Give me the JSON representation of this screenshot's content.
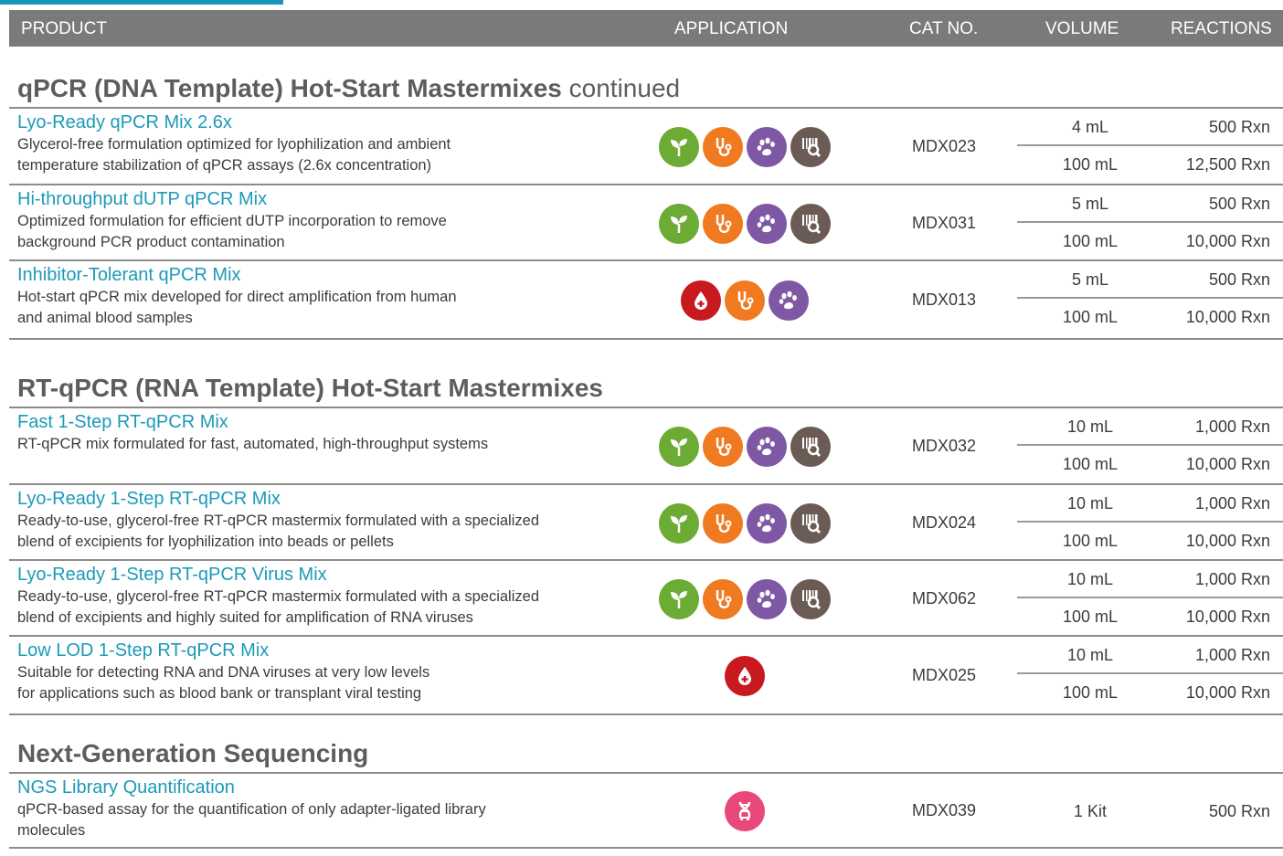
{
  "header": {
    "product": "PRODUCT",
    "application": "APPLICATION",
    "cat_no": "CAT NO.",
    "volume": "VOLUME",
    "reactions": "REACTIONS"
  },
  "colors": {
    "accent": "#1795b5",
    "header_bg": "#7a7a7a",
    "product_name": "#1c9ab8",
    "plant": "#6cab34",
    "medical": "#ef7a1f",
    "veterinary": "#7e58a5",
    "forensic": "#6b5b55",
    "blood": "#c8191f",
    "dna": "#e8497a"
  },
  "sections": [
    {
      "title": "qPCR (DNA Template) Hot-Start Mastermixes",
      "title_suffix": "continued",
      "products": [
        {
          "name": "Lyo-Ready qPCR Mix 2.6x",
          "desc1": "Glycerol-free formulation optimized for lyophilization and ambient",
          "desc2": "temperature stabilization of qPCR assays (2.6x concentration)",
          "icons": [
            "plant-icon",
            "stethoscope-icon",
            "paw-icon",
            "barcode-search-icon"
          ],
          "cat": "MDX023",
          "sizes": [
            {
              "volume": "4 mL",
              "reactions": "500 Rxn"
            },
            {
              "volume": "100 mL",
              "reactions": "12,500 Rxn"
            }
          ]
        },
        {
          "name": "Hi-throughput dUTP qPCR Mix",
          "desc1": "Optimized formulation for efficient dUTP incorporation to remove",
          "desc2": "background PCR product contamination",
          "icons": [
            "plant-icon",
            "stethoscope-icon",
            "paw-icon",
            "barcode-search-icon"
          ],
          "cat": "MDX031",
          "sizes": [
            {
              "volume": "5 mL",
              "reactions": "500 Rxn"
            },
            {
              "volume": "100 mL",
              "reactions": "10,000 Rxn"
            }
          ]
        },
        {
          "name": "Inhibitor-Tolerant qPCR Mix",
          "desc1": "Hot-start qPCR mix developed for direct amplification from human",
          "desc2": "and animal blood samples",
          "icons": [
            "blood-drop-icon",
            "stethoscope-icon",
            "paw-icon"
          ],
          "cat": "MDX013",
          "sizes": [
            {
              "volume": "5 mL",
              "reactions": "500 Rxn"
            },
            {
              "volume": "100 mL",
              "reactions": "10,000 Rxn"
            }
          ]
        }
      ]
    },
    {
      "title": "RT-qPCR (RNA Template) Hot-Start Mastermixes",
      "title_suffix": "",
      "products": [
        {
          "name": "Fast 1-Step RT-qPCR Mix",
          "desc1": "RT-qPCR mix formulated for fast, automated, high-throughput systems",
          "desc2": "",
          "icons": [
            "plant-icon",
            "stethoscope-icon",
            "paw-icon",
            "barcode-search-icon"
          ],
          "cat": "MDX032",
          "sizes": [
            {
              "volume": "10 mL",
              "reactions": "1,000 Rxn"
            },
            {
              "volume": "100 mL",
              "reactions": "10,000 Rxn"
            }
          ]
        },
        {
          "name": "Lyo-Ready 1-Step RT-qPCR Mix",
          "desc1": "Ready-to-use, glycerol-free RT-qPCR mastermix formulated with a specialized",
          "desc2": "blend of excipients for lyophilization into beads or pellets",
          "icons": [
            "plant-icon",
            "stethoscope-icon",
            "paw-icon",
            "barcode-search-icon"
          ],
          "cat": "MDX024",
          "sizes": [
            {
              "volume": "10 mL",
              "reactions": "1,000 Rxn"
            },
            {
              "volume": "100 mL",
              "reactions": "10,000 Rxn"
            }
          ]
        },
        {
          "name": "Lyo-Ready 1-Step RT-qPCR Virus Mix",
          "desc1": "Ready-to-use, glycerol-free RT-qPCR mastermix formulated with a specialized",
          "desc2": "blend of excipients and highly suited for amplification of RNA viruses",
          "icons": [
            "plant-icon",
            "stethoscope-icon",
            "paw-icon",
            "barcode-search-icon"
          ],
          "cat": "MDX062",
          "sizes": [
            {
              "volume": "10 mL",
              "reactions": "1,000 Rxn"
            },
            {
              "volume": "100 mL",
              "reactions": "10,000 Rxn"
            }
          ]
        },
        {
          "name": "Low LOD 1-Step RT-qPCR Mix",
          "desc1": "Suitable for detecting RNA and DNA viruses at very low levels",
          "desc2": "for applications such as blood bank or transplant viral testing",
          "icons": [
            "blood-drop-icon"
          ],
          "cat": "MDX025",
          "sizes": [
            {
              "volume": "10 mL",
              "reactions": "1,000 Rxn"
            },
            {
              "volume": "100 mL",
              "reactions": "10,000 Rxn"
            }
          ]
        }
      ]
    },
    {
      "title": "Next-Generation Sequencing",
      "title_suffix": "",
      "products": [
        {
          "name": "NGS Library Quantification",
          "desc1": "qPCR-based assay for the quantification of only adapter-ligated library",
          "desc2": "molecules",
          "icons": [
            "dna-icon"
          ],
          "cat": "MDX039",
          "sizes": [
            {
              "volume": "1 Kit",
              "reactions": "500 Rxn"
            }
          ]
        }
      ]
    }
  ]
}
